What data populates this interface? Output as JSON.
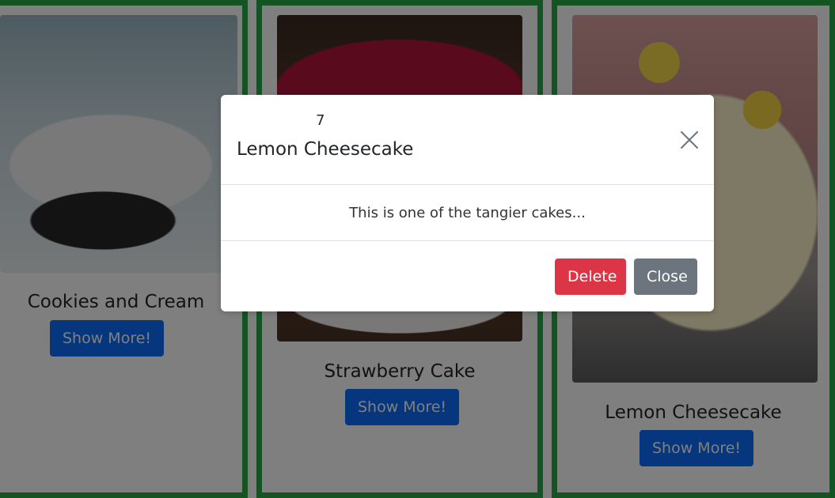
{
  "cards": [
    {
      "title": "Cookies and Cream",
      "button": "Show More!"
    },
    {
      "title": "Strawberry Cake",
      "button": "Show More!"
    },
    {
      "title": "Lemon Cheesecake",
      "button": "Show More!"
    }
  ],
  "modal": {
    "number": "7",
    "title": "Lemon Cheesecake",
    "body": "This is one of the tangier cakes...",
    "delete_label": "Delete",
    "close_label": "Close"
  },
  "colors": {
    "card_border": "#28a745",
    "primary": "#0d6efd",
    "danger": "#dc3545",
    "secondary": "#6c757d"
  },
  "icons": {
    "modal_close": "close-icon"
  }
}
